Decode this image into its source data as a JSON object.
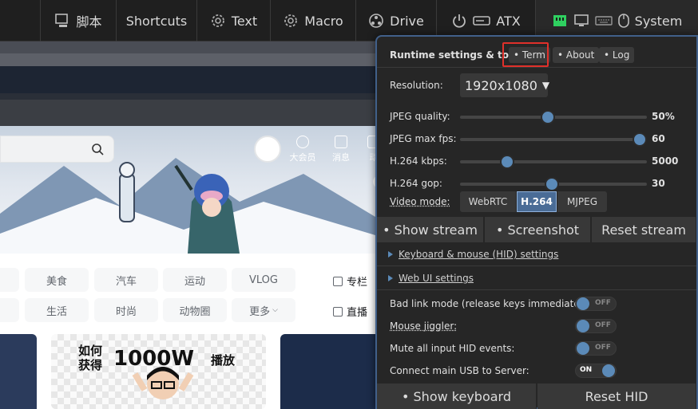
{
  "menu": {
    "script": "脚本",
    "shortcuts": "Shortcuts",
    "text": "Text",
    "macro": "Macro",
    "drive": "Drive",
    "atx": "ATX",
    "system": "System"
  },
  "stream": {
    "top_nav": [
      "大会员",
      "消息",
      "动"
    ],
    "tags_row1": [
      "美食",
      "汽车",
      "运动",
      "VLOG"
    ],
    "tags_row2": [
      "生活",
      "时尚",
      "动物圈",
      "更多"
    ],
    "side_links": [
      "专栏",
      "直播"
    ],
    "card2_big": "1000W",
    "card2_small": "如何获得",
    "card2_tail": "播放"
  },
  "panel": {
    "title": "Runtime settings & tools",
    "tabs": [
      "• Term",
      "• About",
      "• Log"
    ],
    "resolution_label": "Resolution:",
    "resolution_value": "1920x1080",
    "sliders": [
      {
        "label": "JPEG quality:",
        "value": "50%",
        "level": 0.47
      },
      {
        "label": "JPEG max fps:",
        "value": "60",
        "level": 0.96
      },
      {
        "label": "H.264 kbps:",
        "value": "5000",
        "level": 0.25
      },
      {
        "label": "H.264 gop:",
        "value": "30",
        "level": 0.49
      }
    ],
    "video_mode_label": "Video mode:",
    "video_modes": [
      "WebRTC",
      "H.264",
      "MJPEG"
    ],
    "video_mode_selected": "H.264",
    "stream_buttons": [
      "• Show stream",
      "• Screenshot",
      "Reset stream"
    ],
    "links": [
      "Keyboard & mouse (HID) settings",
      "Web UI settings"
    ],
    "toggles": [
      {
        "label": "Bad link mode (release keys immediately):",
        "state": "OFF"
      },
      {
        "label": "Mouse jiggler:",
        "state": "OFF"
      },
      {
        "label": "Mute all input HID events:",
        "state": "OFF"
      },
      {
        "label": "Connect main USB to Server:",
        "state": "ON"
      }
    ],
    "bottom_buttons": [
      "• Show keyboard",
      "Reset HID"
    ]
  },
  "colors": {
    "accent": "#5b8ab8",
    "panel_border": "#41608a",
    "highlight": "#e0302a",
    "usb_icon": "#2fd060"
  }
}
